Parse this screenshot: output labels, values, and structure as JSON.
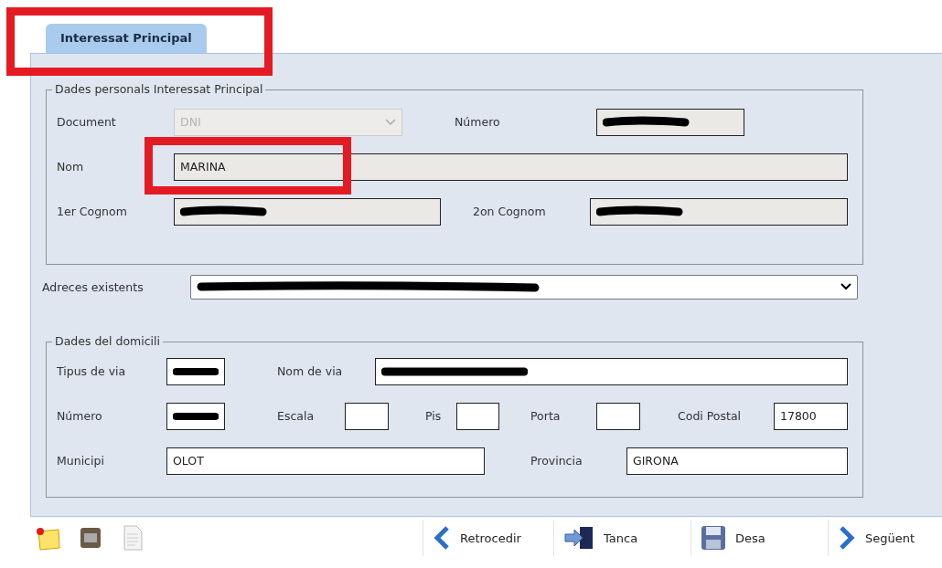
{
  "tabs": [
    {
      "label": "Interessat Principal",
      "selected": true
    }
  ],
  "personal": {
    "legend": "Dades personals Interessat Principal",
    "rows": [
      {
        "fields": [
          {
            "label": "Document",
            "kind": "select",
            "value": "DNI",
            "disabled": true
          },
          {
            "label": "Número",
            "kind": "text",
            "redacted": true
          }
        ]
      },
      {
        "fields": [
          {
            "label": "Nom",
            "kind": "text",
            "value": "MARINA"
          }
        ]
      },
      {
        "fields": [
          {
            "label": "1er Cognom",
            "kind": "text",
            "redacted": true
          },
          {
            "label": "2on Cognom",
            "kind": "text",
            "redacted": true
          }
        ]
      }
    ]
  },
  "addresses": {
    "label": "Adreces existents",
    "redacted": true
  },
  "home": {
    "legend": "Dades del domicili",
    "rows": [
      {
        "fields": [
          {
            "label": "Tipus de via",
            "redacted": true
          },
          {
            "label": "Nom de via",
            "redacted": true
          }
        ]
      },
      {
        "fields": [
          {
            "label": "Número",
            "redacted": true
          },
          {
            "label": "Escala"
          },
          {
            "label": "Pis"
          },
          {
            "label": "Porta"
          },
          {
            "label": "Codi Postal",
            "value": "17800"
          }
        ]
      },
      {
        "fields": [
          {
            "label": "Municipi",
            "value": "OLOT"
          },
          {
            "label": "Provincia",
            "value": "GIRONA"
          }
        ]
      }
    ]
  },
  "toolbar": {
    "tools": [
      {
        "kind": "note"
      },
      {
        "kind": "card"
      },
      {
        "kind": "document"
      }
    ],
    "buttons": [
      {
        "label": "Retrocedir",
        "kind": "back"
      },
      {
        "label": "Tanca",
        "kind": "close"
      },
      {
        "label": "Desa",
        "kind": "save"
      },
      {
        "label": "Següent",
        "kind": "next"
      }
    ]
  }
}
